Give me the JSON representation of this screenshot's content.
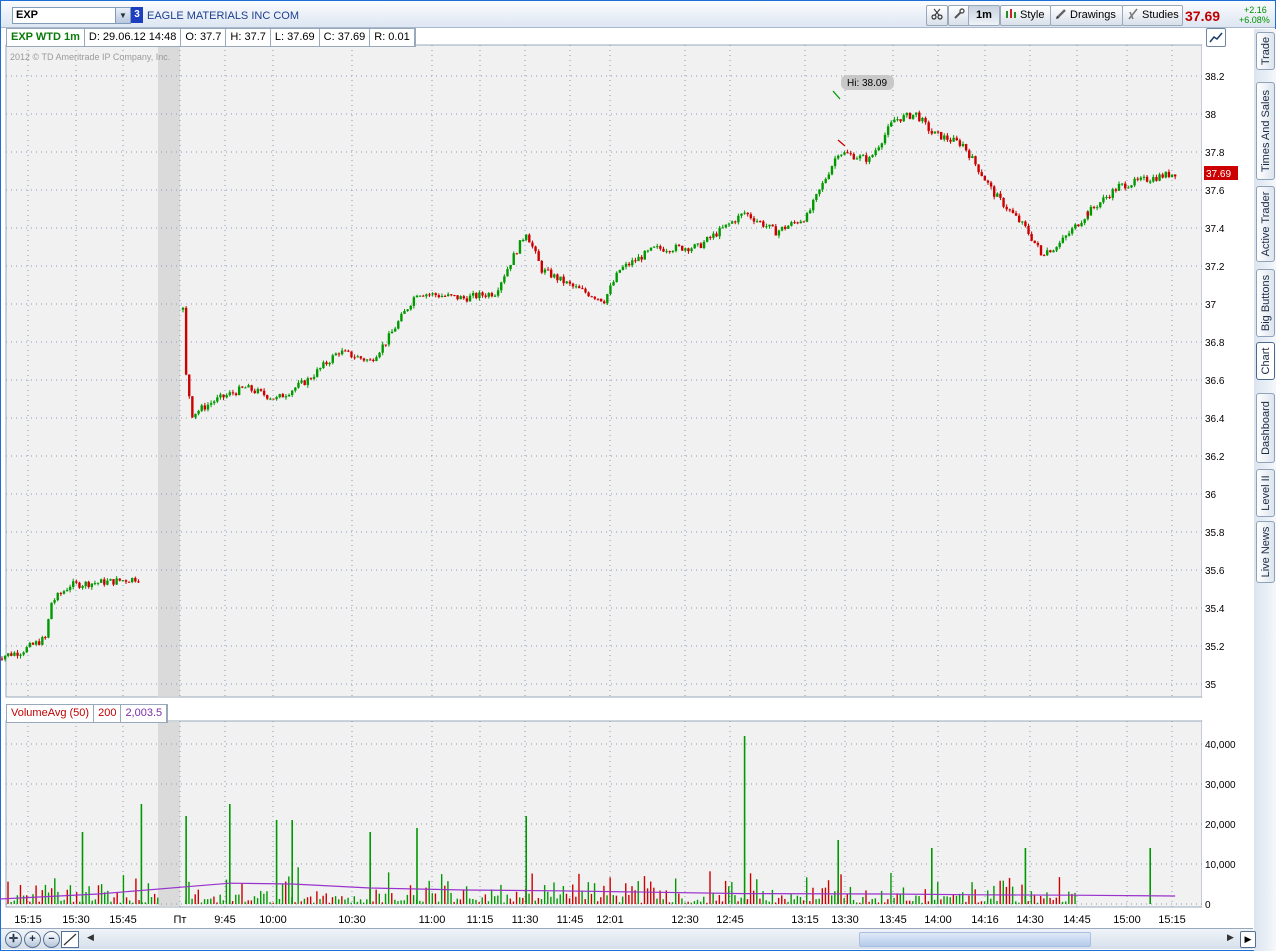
{
  "header": {
    "symbol": "EXP",
    "link_group": "3",
    "company": "EAGLE MATERIALS INC COM",
    "aggregation_button": "1m",
    "style_label": "Style",
    "drawings_label": "Drawings",
    "studies_label": "Studies",
    "last_price": "37.69",
    "change": "+2.16",
    "change_pct": "+6.08%"
  },
  "info_bar": {
    "title": "EXP WTD 1m",
    "date": "D: 29.06.12 14:48",
    "open": "O: 37.7",
    "high": "H: 37.7",
    "low": "L: 37.69",
    "close": "C: 37.69",
    "range": "R: 0.01"
  },
  "watermark": "2012 © TD Ameritrade IP Company, Inc.",
  "volume_info": {
    "study": "VolumeAvg (50)",
    "volume": "200",
    "average": "2,003.5"
  },
  "side_tabs": [
    "Trade",
    "Times And Sales",
    "Active Trader",
    "Big Buttons",
    "Chart",
    "Dashboard",
    "Level II",
    "Live News"
  ],
  "active_side_tab": "Chart",
  "colors": {
    "up": "#009900",
    "down": "#cc0000",
    "avg_line": "#9933cc",
    "price_tag": "#cc0000",
    "grid": "#8a9ab5"
  },
  "chart_data": [
    {
      "type": "candlestick",
      "title": "EXP WTD 1m",
      "y_ticks": [
        "38.2",
        "38",
        "37.8",
        "37.6",
        "37.4",
        "37.2",
        "37",
        "36.8",
        "36.6",
        "36.4",
        "36.2",
        "36",
        "35.8",
        "35.6",
        "35.4",
        "35.2",
        "35"
      ],
      "ylim": [
        34.94,
        38.34
      ],
      "x_ticks": [
        "15:15",
        "15:30",
        "15:45",
        "Пт",
        "9:45",
        "10:00",
        "10:30",
        "11:00",
        "11:15",
        "11:30",
        "11:45",
        "12:01",
        "12:30",
        "12:45",
        "13:15",
        "13:30",
        "13:45",
        "14:00",
        "14:16",
        "14:30",
        "14:45",
        "15:00",
        "15:15"
      ],
      "annotation": "Hi: 38.09",
      "high": 38.09,
      "last_price_tag": "37.69",
      "price_path": [
        {
          "x": "15:12",
          "y": 35.14
        },
        {
          "x": "15:20",
          "y": 35.17
        },
        {
          "x": "15:28",
          "y": 35.24
        },
        {
          "x": "15:30",
          "y": 35.43
        },
        {
          "x": "15:36",
          "y": 35.52
        },
        {
          "x": "15:42",
          "y": 35.53
        },
        {
          "x": "15:50",
          "y": 35.54
        },
        {
          "x": "15:59",
          "y": 35.56
        },
        {
          "x": "9:30",
          "y": 36.97
        },
        {
          "x": "9:31",
          "y": 36.62
        },
        {
          "x": "9:33",
          "y": 36.42
        },
        {
          "x": "9:40",
          "y": 36.49
        },
        {
          "x": "9:50",
          "y": 36.56
        },
        {
          "x": "10:00",
          "y": 36.5
        },
        {
          "x": "10:10",
          "y": 36.6
        },
        {
          "x": "10:20",
          "y": 36.75
        },
        {
          "x": "10:30",
          "y": 36.7
        },
        {
          "x": "10:35",
          "y": 36.8
        },
        {
          "x": "10:45",
          "y": 37.06
        },
        {
          "x": "11:00",
          "y": 37.03
        },
        {
          "x": "11:10",
          "y": 37.06
        },
        {
          "x": "11:20",
          "y": 37.38
        },
        {
          "x": "11:25",
          "y": 37.18
        },
        {
          "x": "11:35",
          "y": 37.09
        },
        {
          "x": "11:45",
          "y": 37.02
        },
        {
          "x": "11:50",
          "y": 37.18
        },
        {
          "x": "12:01",
          "y": 37.29
        },
        {
          "x": "12:15",
          "y": 37.3
        },
        {
          "x": "12:30",
          "y": 37.48
        },
        {
          "x": "12:40",
          "y": 37.38
        },
        {
          "x": "12:50",
          "y": 37.46
        },
        {
          "x": "13:00",
          "y": 37.8
        },
        {
          "x": "13:10",
          "y": 37.76
        },
        {
          "x": "13:18",
          "y": 37.97
        },
        {
          "x": "13:25",
          "y": 38.0
        },
        {
          "x": "13:30",
          "y": 37.9
        },
        {
          "x": "13:40",
          "y": 37.84
        },
        {
          "x": "13:50",
          "y": 37.58
        },
        {
          "x": "14:00",
          "y": 37.4
        },
        {
          "x": "14:05",
          "y": 37.27
        },
        {
          "x": "14:10",
          "y": 37.3
        },
        {
          "x": "14:20",
          "y": 37.48
        },
        {
          "x": "14:30",
          "y": 37.62
        },
        {
          "x": "14:40",
          "y": 37.66
        },
        {
          "x": "14:48",
          "y": 37.69
        }
      ]
    },
    {
      "type": "bar",
      "title": "VolumeAvg (50)",
      "y_ticks": [
        "40,000",
        "30,000",
        "20,000",
        "10,000",
        "0"
      ],
      "ylim": [
        0,
        45000
      ],
      "volume_spikes": [
        {
          "x": "15:40",
          "y": 18000
        },
        {
          "x": "15:59",
          "y": 25000
        },
        {
          "x": "9:31",
          "y": 22000
        },
        {
          "x": "9:45",
          "y": 25000
        },
        {
          "x": "10:00",
          "y": 21000
        },
        {
          "x": "10:05",
          "y": 21000
        },
        {
          "x": "10:30",
          "y": 18000
        },
        {
          "x": "10:45",
          "y": 19000
        },
        {
          "x": "11:20",
          "y": 22000
        },
        {
          "x": "12:30",
          "y": 42000
        },
        {
          "x": "13:00",
          "y": 16000
        },
        {
          "x": "13:30",
          "y": 14000
        },
        {
          "x": "14:00",
          "y": 14000
        },
        {
          "x": "14:40",
          "y": 14000
        }
      ],
      "avg_series_name": "VolumeAvg (50)",
      "avg_path": [
        {
          "x": "15:12",
          "y": 1200
        },
        {
          "x": "15:45",
          "y": 2500
        },
        {
          "x": "9:45",
          "y": 5200
        },
        {
          "x": "10:05",
          "y": 5000
        },
        {
          "x": "10:30",
          "y": 4000
        },
        {
          "x": "11:00",
          "y": 3500
        },
        {
          "x": "11:30",
          "y": 3300
        },
        {
          "x": "12:30",
          "y": 2600
        },
        {
          "x": "13:15",
          "y": 2500
        },
        {
          "x": "13:45",
          "y": 2300
        },
        {
          "x": "14:15",
          "y": 2200
        },
        {
          "x": "14:48",
          "y": 2000
        }
      ]
    }
  ]
}
